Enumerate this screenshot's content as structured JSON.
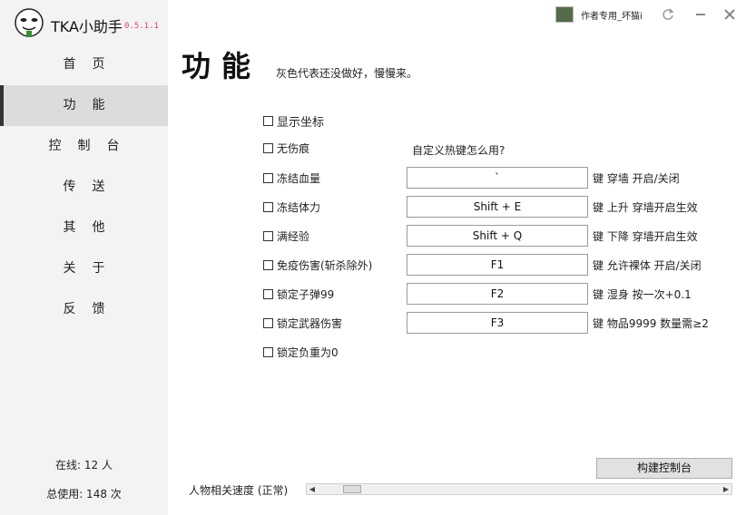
{
  "app": {
    "title": "TKA小助手",
    "version": "0.5.1.1"
  },
  "sidebar": {
    "items": [
      {
        "label": "首页"
      },
      {
        "label": "功能"
      },
      {
        "label": "控制台"
      },
      {
        "label": "传送"
      },
      {
        "label": "其他"
      },
      {
        "label": "关于"
      },
      {
        "label": "反馈"
      }
    ],
    "active_index": 1,
    "online": "在线: 12 人",
    "total_usage": "总使用: 148 次"
  },
  "titlebar": {
    "user_name": "作者专用_坏猫i",
    "icons": [
      "refresh-icon",
      "minimize-icon",
      "close-icon"
    ]
  },
  "page": {
    "title": "功能",
    "subtitle": "灰色代表还没做好，慢慢来。"
  },
  "options": {
    "show_coords": "显示坐标",
    "no_damage": "无伤痕",
    "freeze_hp": "冻结血量",
    "freeze_stamina": "冻结体力",
    "max_exp": "满经验",
    "immune_damage": "免疫伤害(斩杀除外)",
    "lock_ammo": "锁定子弹99",
    "lock_weapon_damage": "锁定武器伤害",
    "lock_weight": "锁定负重为0"
  },
  "hotkeys": {
    "help": "自定义热键怎么用?",
    "rows": [
      {
        "key": "`",
        "suffix": "键 穿墙 开启/关闭"
      },
      {
        "key": "Shift + E",
        "suffix": "键 上升 穿墙开启生效"
      },
      {
        "key": "Shift + Q",
        "suffix": "键 下降 穿墙开启生效"
      },
      {
        "key": "F1",
        "suffix": "键 允许裸体 开启/关闭"
      },
      {
        "key": "F2",
        "suffix": "键 湿身 按一次+0.1"
      },
      {
        "key": "F3",
        "suffix": "键 物品9999 数量需≥2"
      }
    ]
  },
  "footer": {
    "build_console": "构建控制台",
    "speed_label": "人物相关速度 (正常)",
    "speed_value": 0.02
  },
  "colors": {
    "sidebar_bg": "#f3f3f3",
    "active_bg": "#dcdcdc",
    "version": "#e0407a"
  }
}
